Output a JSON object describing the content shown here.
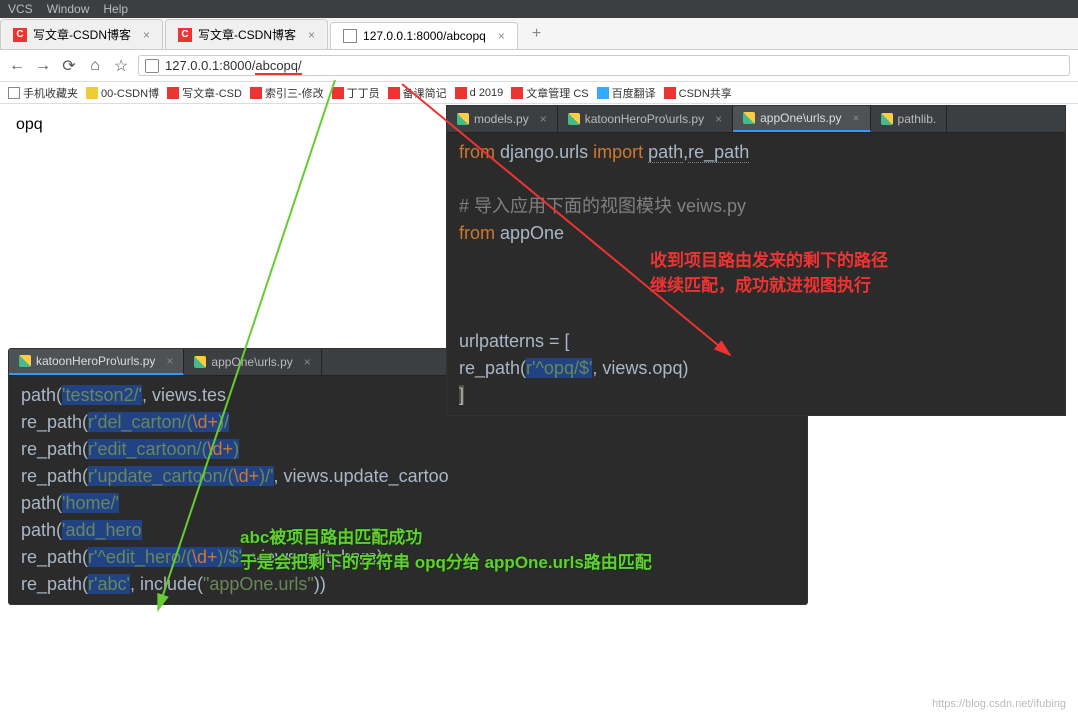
{
  "menubar": {
    "vcs": "VCS",
    "window": "Window",
    "help": "Help"
  },
  "browser": {
    "tabs": [
      {
        "icon": "csdn",
        "label": "写文章-CSDN博客"
      },
      {
        "icon": "csdn",
        "label": "写文章-CSDN博客"
      },
      {
        "icon": "doc",
        "label": "127.0.0.1:8000/abcopq"
      }
    ],
    "url_prefix": "127.0.0.1:8000/",
    "url_match": "abcopq/",
    "bookmarks": [
      {
        "ico": "w",
        "t": "手机收藏夹"
      },
      {
        "ico": "y",
        "t": "00-CSDN博"
      },
      {
        "ico": "r",
        "t": "写文章-CSD"
      },
      {
        "ico": "r",
        "t": "索引三-修改"
      },
      {
        "ico": "r",
        "t": "丁丁员"
      },
      {
        "ico": "r",
        "t": "备课简记"
      },
      {
        "ico": "r",
        "t": "d         2019"
      },
      {
        "ico": "r",
        "t": "文章管理 CS"
      },
      {
        "ico": "b",
        "t": "百度翻译"
      },
      {
        "ico": "r",
        "t": "CSDN共享"
      }
    ],
    "page_text": "opq"
  },
  "ide_top": {
    "tabs": [
      {
        "label": "models.py"
      },
      {
        "label": "katoonHeroPro\\urls.py"
      },
      {
        "label": "appOne\\urls.py",
        "active": true
      },
      {
        "label": "pathlib."
      }
    ],
    "code": {
      "l1": {
        "a": "from ",
        "b": "django.urls ",
        "c": "import ",
        "d": "path",
        "e": ",",
        "f": "re_path"
      },
      "cmt": "# 导入应用下面的视图模块 veiws.py",
      "l2": {
        "a": "from ",
        "b": "appOne"
      },
      "l4": "urlpatterns = [",
      "l5": {
        "a": "    re_path(",
        "b": "r'^opq/$'",
        "c": ", views.opq)"
      },
      "l6": "]"
    }
  },
  "ide_bottom": {
    "tabs": [
      {
        "label": "katoonHeroPro\\urls.py",
        "active": true
      },
      {
        "label": "appOne\\urls.py"
      }
    ],
    "code": {
      "l1": {
        "a": "path(",
        "b": "'testson2/'",
        "c": ", views.tes"
      },
      "l2": {
        "a": "re_path(",
        "b": "r'del_carton/(",
        "c": "\\d+",
        ")/": "/"
      },
      "l3": {
        "a": "re_path(",
        "b": "r'edit_cartoon/(",
        "c": "\\d+"
      },
      "l4": {
        "a": "re_path(",
        "b": "r'update_cartoon/(",
        "c": "\\d+",
        "d": ")/'",
        "e": ", views.update_cartoo"
      },
      "l5": {
        "a": "path(",
        "b": "'home/'"
      },
      "l6": {
        "a": "path(",
        "b": "'add_hero"
      },
      "l7": {
        "a": "re_path(",
        "b": "r'^edit_hero/(",
        "c": "\\d+",
        "d": ")/$'",
        "e": ", views.edit_hero),"
      },
      "l8": {
        "a": "re_path(",
        "b": "r'abc'",
        "c": ", include(",
        "d": "\"appOne.urls\"",
        "e": "))"
      }
    }
  },
  "annotations": {
    "green1": "abc被项目路由匹配成功",
    "green2": "于是会把剩下的字符串 opq分给 appOne.urls路由匹配",
    "red1": "收到项目路由发来的剩下的路径",
    "red2": "继续匹配，成功就进视图执行"
  },
  "watermark": "https://blog.csdn.net/ifubing"
}
